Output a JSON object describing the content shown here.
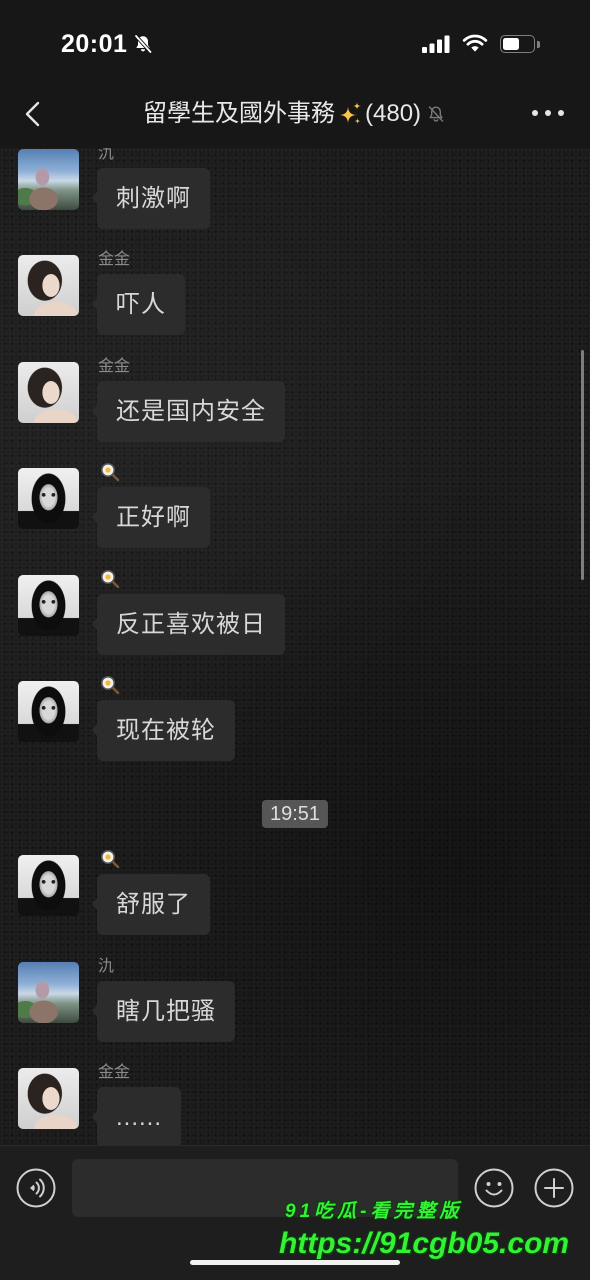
{
  "status_bar": {
    "time": "20:01",
    "battery_level": 0.55,
    "icons": [
      "bell-slash-icon",
      "signal-icon",
      "wifi-icon",
      "battery-icon"
    ]
  },
  "nav": {
    "back_icon": "chevron-left-icon",
    "title": "留學生及國外事務",
    "title_icon": "sparkles-icon",
    "member_count": "(480)",
    "mute_icon": "bell-slash-icon",
    "more_icon": "more-icon"
  },
  "messages": [
    {
      "sender": "氿",
      "text": "刺激啊"
    },
    {
      "sender": "金金",
      "text": "吓人"
    },
    {
      "sender": "金金",
      "text": "还是国内安全"
    },
    {
      "sender_icon": "fried-egg-icon",
      "text": "正好啊"
    },
    {
      "sender_icon": "fried-egg-icon",
      "text": "反正喜欢被日"
    },
    {
      "sender_icon": "fried-egg-icon",
      "text": "现在被轮"
    },
    {
      "timestamp": "19:51"
    },
    {
      "sender_icon": "fried-egg-icon",
      "text": "舒服了"
    },
    {
      "sender": "氿",
      "text": "瞎几把骚"
    },
    {
      "sender": "金金",
      "text": "......"
    }
  ],
  "input_bar": {
    "voice_icon": "voice-icon",
    "emoji_icon": "emoji-icon",
    "plus_icon": "plus-icon"
  },
  "watermark": {
    "line1": "91吃瓜-看完整版",
    "line2": "https://91cgb05.com"
  },
  "colors": {
    "background": "#1b1b1b",
    "bubble": "#2c2c2c",
    "timestamp_pill": "#565656",
    "watermark_green": "#33f236"
  }
}
